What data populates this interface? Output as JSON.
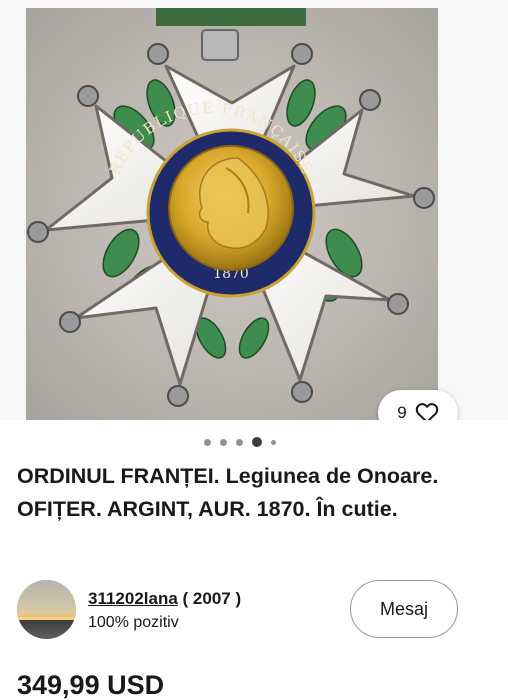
{
  "listing": {
    "image_alt": "Medal photo",
    "medal_inscription": "REPUBLIQUE FRANÇAISE",
    "medal_year": "1870",
    "likes": "9",
    "carousel": {
      "count": 5,
      "active_index": 3
    },
    "title": "ORDINUL FRANȚEI. Legiunea de Onoare. OFIȚER. ARGINT, AUR. 1870. În cutie.",
    "price": "349,99 USD"
  },
  "seller": {
    "username": "311202lana",
    "score": "( 2007 )",
    "feedback": "100% pozitiv",
    "message_label": "Mesaj"
  },
  "icons": {
    "like": "heart-outline-icon"
  },
  "colors": {
    "text": "#191919",
    "enamel_blue": "#1f2a6b",
    "gold": "#d9a72a",
    "enamel_green": "#3f8c4f"
  }
}
